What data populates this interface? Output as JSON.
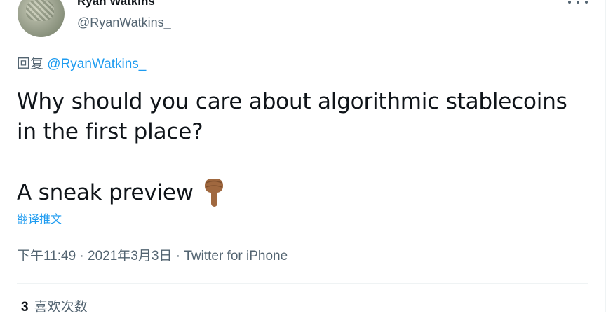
{
  "author": {
    "display_name": "Ryan Watkins",
    "handle": "@RyanWatkins_"
  },
  "reply": {
    "prefix": "回复",
    "mention": "@RyanWatkins_"
  },
  "tweet": {
    "line1": "Why should you care about algorithmic stablecoins in the first place?",
    "line2": "A sneak preview"
  },
  "translate_label": "翻译推文",
  "meta": {
    "time": "下午11:49",
    "sep1": " · ",
    "date": "2021年3月3日",
    "sep2": " · ",
    "source": "Twitter for iPhone"
  },
  "stats": {
    "likes_count": "3",
    "likes_label": "喜欢次数"
  },
  "icons": {
    "more": "more-horizontal-icon",
    "emoji": "backhand-index-pointing-down-icon"
  },
  "colors": {
    "accent": "#1d9bf0",
    "secondary_text": "#536471",
    "primary_text": "#0f1419",
    "emoji_skin": "#a0683f"
  }
}
